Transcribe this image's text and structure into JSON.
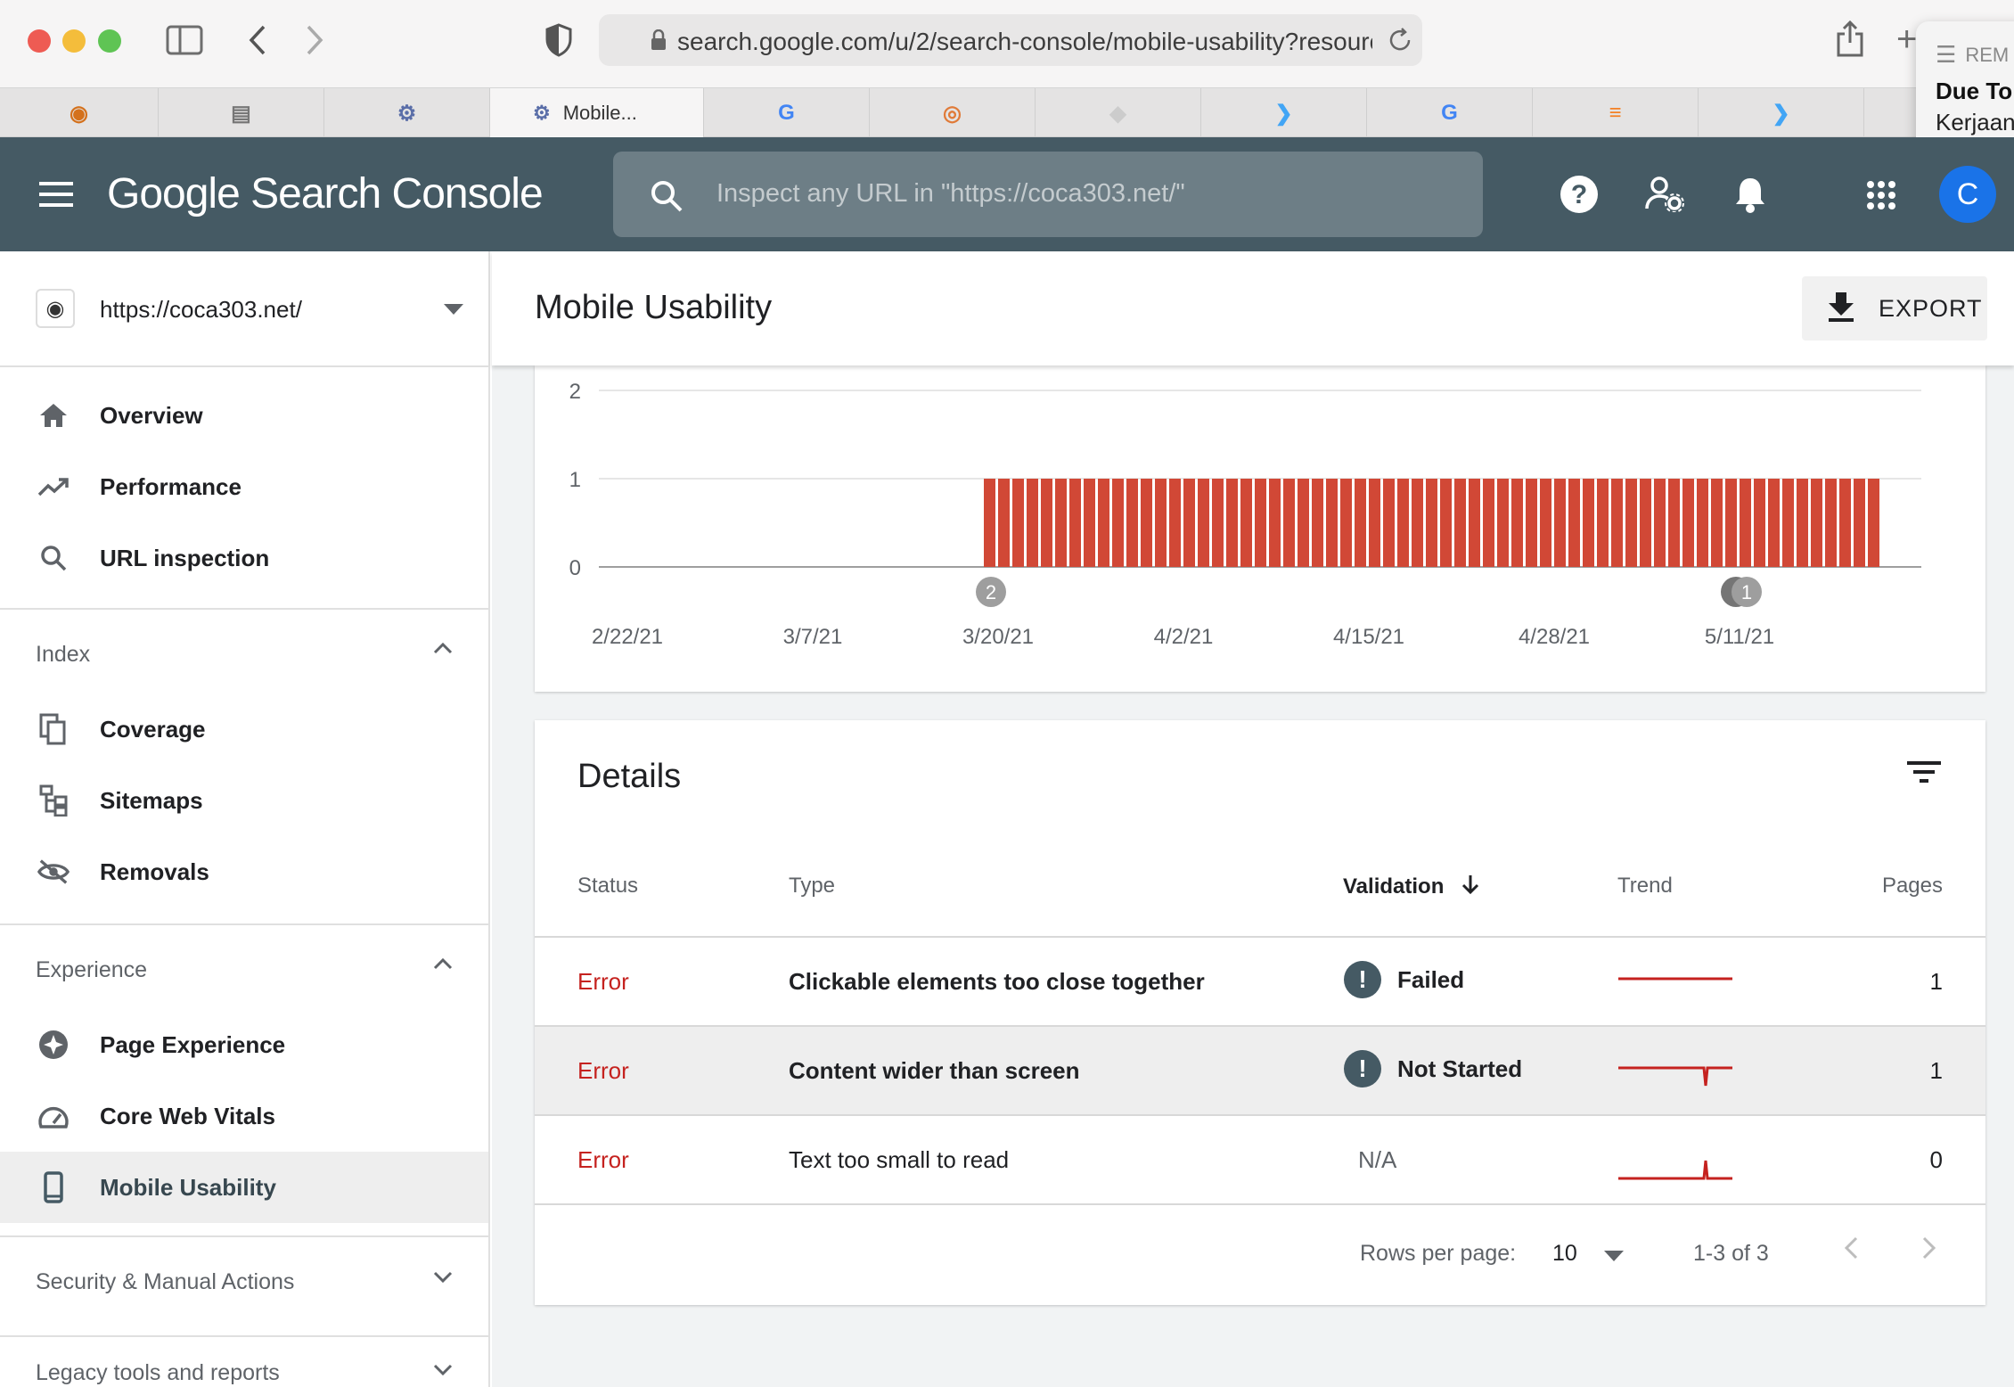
{
  "browser": {
    "url": "search.google.com/u/2/search-console/mobile-usability?resourc",
    "active_tab_label": "Mobile...",
    "reminder": {
      "title": "REM",
      "line1": "Due To",
      "line2": "Kerjaan"
    }
  },
  "header": {
    "brand": "Google Search Console",
    "search_placeholder": "Inspect any URL in \"https://coca303.net/\"",
    "avatar_letter": "C"
  },
  "property": {
    "url": "https://coca303.net/"
  },
  "sidebar": {
    "top_items": [
      {
        "label": "Overview"
      },
      {
        "label": "Performance"
      },
      {
        "label": "URL inspection"
      }
    ],
    "index": {
      "heading": "Index",
      "items": [
        {
          "label": "Coverage"
        },
        {
          "label": "Sitemaps"
        },
        {
          "label": "Removals"
        }
      ]
    },
    "experience": {
      "heading": "Experience",
      "items": [
        {
          "label": "Page Experience"
        },
        {
          "label": "Core Web Vitals"
        },
        {
          "label": "Mobile Usability"
        }
      ]
    },
    "security_heading": "Security & Manual Actions",
    "legacy_heading": "Legacy tools and reports"
  },
  "page": {
    "title": "Mobile Usability",
    "export_label": "EXPORT"
  },
  "chart_data": {
    "type": "bar",
    "y_ticks": [
      "2",
      "1",
      "0"
    ],
    "ylim": [
      0,
      2
    ],
    "x_tick_labels": [
      "2/22/21",
      "3/7/21",
      "3/20/21",
      "4/2/21",
      "4/15/21",
      "4/28/21",
      "5/11/21"
    ],
    "bar_start_date": "3/19/21",
    "bar_end_date": "5/20/21",
    "bar_value": 1,
    "bar_color": "#d14836",
    "annotations": [
      {
        "label": "2",
        "date": "3/19/21"
      },
      {
        "label": "1",
        "date": "5/11/21"
      }
    ]
  },
  "details": {
    "title": "Details",
    "columns": {
      "status": "Status",
      "type": "Type",
      "validation": "Validation",
      "trend": "Trend",
      "pages": "Pages"
    },
    "rows": [
      {
        "status": "Error",
        "type": "Clickable elements too close together",
        "validation": "Failed",
        "pages": "1"
      },
      {
        "status": "Error",
        "type": "Content wider than screen",
        "validation": "Not Started",
        "pages": "1"
      },
      {
        "status": "Error",
        "type": "Text too small to read",
        "validation": "N/A",
        "pages": "0"
      }
    ],
    "pagination": {
      "rows_per_page_label": "Rows per page:",
      "rows_per_page": "10",
      "range": "1-3 of 3"
    }
  },
  "colors": {
    "header_bg": "#455a64",
    "error": "#c5221f",
    "bar": "#d14836",
    "avatar": "#1a73e8"
  }
}
